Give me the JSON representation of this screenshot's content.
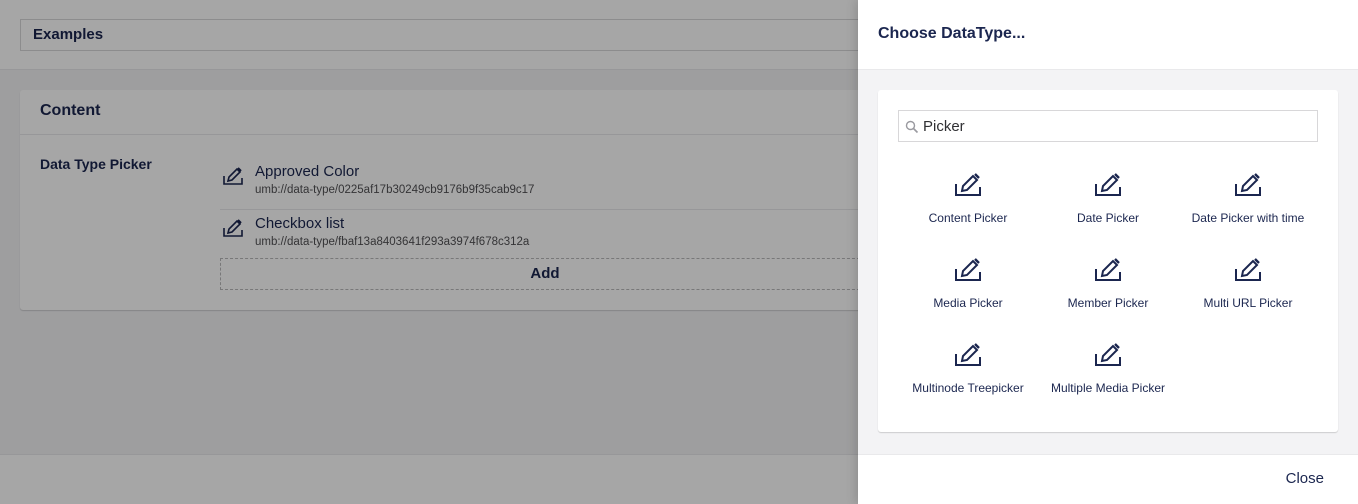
{
  "background": {
    "name_field_value": "Examples",
    "group_title": "Content",
    "property_label": "Data Type Picker",
    "picked_items": [
      {
        "name": "Approved Color",
        "udi": "umb://data-type/0225af17b30249cb9176b9f35cab9c17",
        "icon": "edit-icon"
      },
      {
        "name": "Checkbox list",
        "udi": "umb://data-type/fbaf13a8403641f293a3974f678c312a",
        "icon": "edit-icon"
      }
    ],
    "add_label": "Add"
  },
  "panel": {
    "title": "Choose DataType...",
    "search": {
      "value": "Picker",
      "icon": "search-icon"
    },
    "items": [
      {
        "label": "Content Picker",
        "icon": "edit-icon"
      },
      {
        "label": "Date Picker",
        "icon": "edit-icon"
      },
      {
        "label": "Date Picker with time",
        "icon": "edit-icon"
      },
      {
        "label": "Media Picker",
        "icon": "edit-icon"
      },
      {
        "label": "Member Picker",
        "icon": "edit-icon"
      },
      {
        "label": "Multi URL Picker",
        "icon": "edit-icon"
      },
      {
        "label": "Multinode Treepicker",
        "icon": "edit-icon"
      },
      {
        "label": "Multiple Media Picker",
        "icon": "edit-icon"
      }
    ],
    "close_label": "Close"
  },
  "colors": {
    "text": "#1b264f",
    "overlay": "#000000",
    "panel_bg": "#f3f3f5"
  }
}
